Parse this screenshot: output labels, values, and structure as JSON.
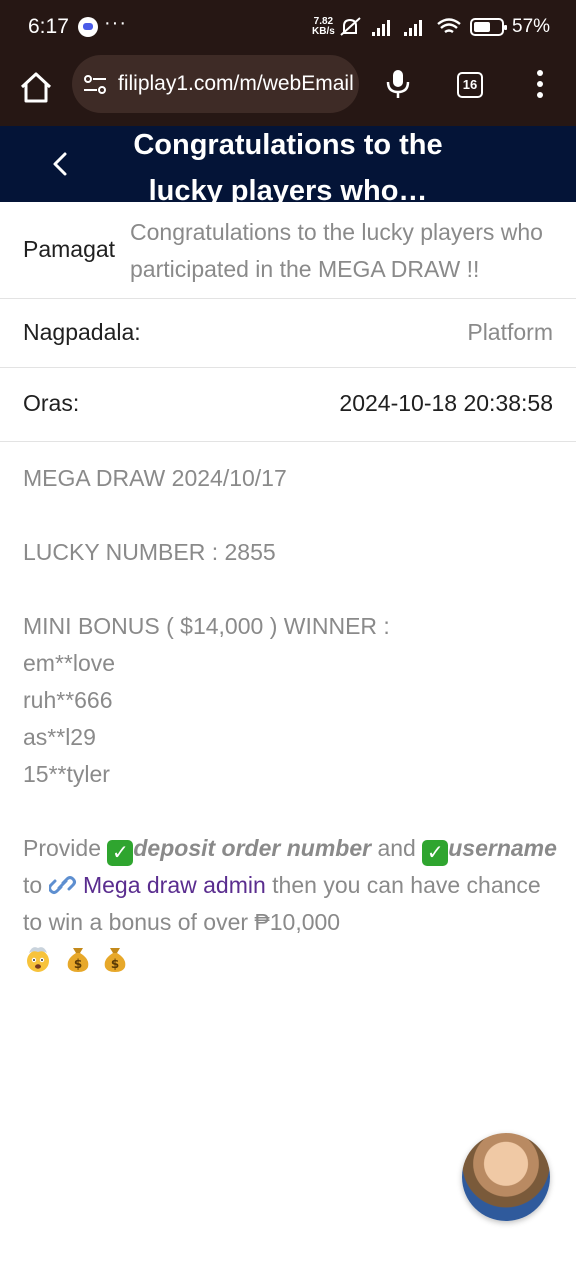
{
  "status_bar": {
    "time": "6:17",
    "dots": "···",
    "speed_value": "7.82",
    "speed_unit": "KB/s",
    "battery": "57%"
  },
  "browser": {
    "url": "filiplay1.com/m/webEmail",
    "tab_count": "16"
  },
  "header": {
    "title": "Congratulations to the lucky players who…"
  },
  "details": {
    "title_label": "Pamagat",
    "title_value": "Congratulations to the lucky players who participated in the MEGA DRAW !!",
    "sender_label": "Nagpadala:",
    "sender_value": "Platform",
    "time_label": "Oras:",
    "time_value": "2024-10-18 20:38:58"
  },
  "message": {
    "line1": "MEGA DRAW 2024/10/17",
    "line2": "LUCKY NUMBER : 2855",
    "line3": "MINI BONUS ( $14,000 ) WINNER :",
    "winners": [
      "em**love",
      "ruh**666",
      "as**l29",
      "15**tyler"
    ],
    "provide": "Provide",
    "deposit_order": "deposit order number",
    "and": "and",
    "username": "username",
    "to": "to",
    "link_text": "Mega draw admin",
    "closing": "then you can have chance to win a bonus of over ₱10,000",
    "check_icon": "✓"
  },
  "colors": {
    "status_bg": "#261714",
    "header_bg": "#041437",
    "link": "#5a2d8f",
    "check_green": "#2fa52f"
  }
}
